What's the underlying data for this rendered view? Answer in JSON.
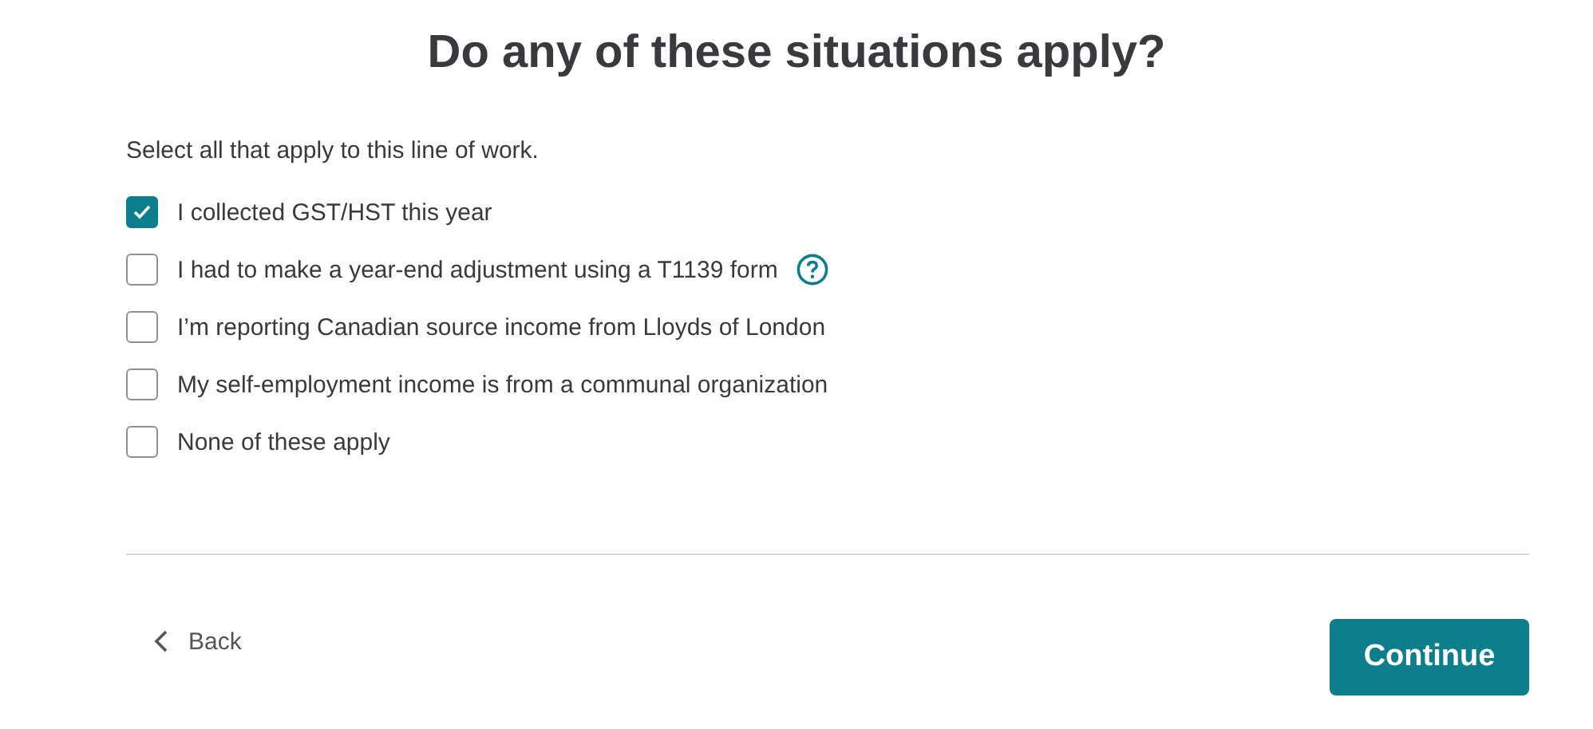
{
  "title": "Do any of these situations apply?",
  "instruction": "Select all that apply to this line of work.",
  "options": [
    {
      "label": "I collected GST/HST this year",
      "checked": true,
      "help": false
    },
    {
      "label": "I had to make a year-end adjustment using a T1139 form",
      "checked": false,
      "help": true
    },
    {
      "label": "I’m reporting Canadian source income from Lloyds of London",
      "checked": false,
      "help": false
    },
    {
      "label": "My self-employment income is from a communal organization",
      "checked": false,
      "help": false
    },
    {
      "label": "None of these apply",
      "checked": false,
      "help": false
    }
  ],
  "back": "Back",
  "continue": "Continue"
}
